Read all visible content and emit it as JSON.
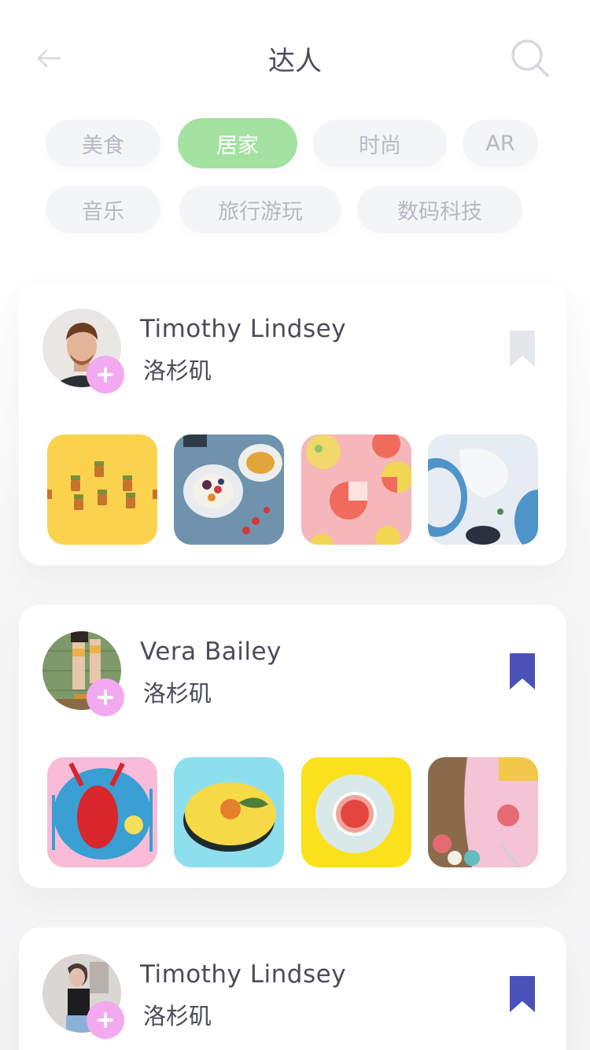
{
  "header": {
    "title": "达人",
    "back_icon": "arrow-left-icon",
    "search_icon": "search-icon"
  },
  "categories": [
    {
      "label": "美食",
      "active": false
    },
    {
      "label": "居家",
      "active": true
    },
    {
      "label": "时尚",
      "active": false
    },
    {
      "label": "AR",
      "active": false
    },
    {
      "label": "音乐",
      "active": false
    },
    {
      "label": "旅行游玩",
      "active": false
    },
    {
      "label": "数码科技",
      "active": false
    }
  ],
  "colors": {
    "active_chip": "#a3e2a1",
    "chip_bg": "#f4f5f7",
    "add_badge": "#f3a9ef",
    "bookmark_saved": "#4a52b8",
    "bookmark_unsaved": "#e3e6ea"
  },
  "users": [
    {
      "name": "Timothy Lindsey",
      "location": "洛杉矶",
      "bookmarked": false,
      "photos": [
        "jars-on-yellow",
        "breakfast-bowl",
        "macarons-on-pink",
        "blue-plates"
      ]
    },
    {
      "name": "Vera Bailey",
      "location": "洛杉矶",
      "bookmarked": true,
      "photos": [
        "lobster-on-plate",
        "yellow-plate-fruit",
        "grapefruit-on-plate",
        "macarons-and-basket"
      ]
    },
    {
      "name": "Timothy Lindsey",
      "location": "洛杉矶",
      "bookmarked": true,
      "photos": []
    }
  ]
}
